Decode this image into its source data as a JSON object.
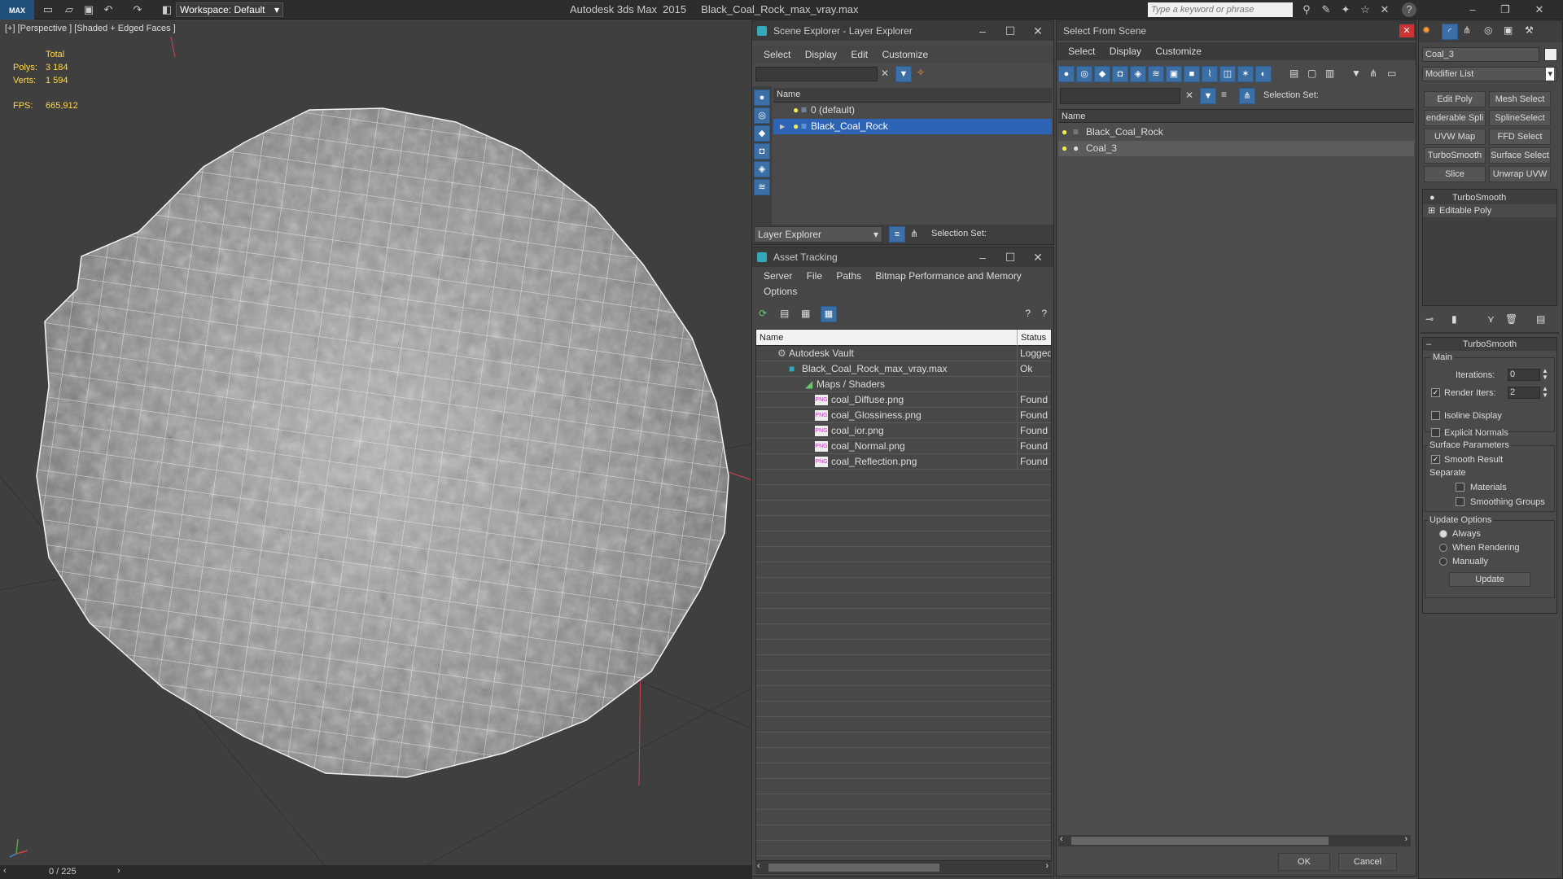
{
  "app": {
    "logo": "MAX",
    "workspace_label": "Workspace: Default",
    "window_title": "Autodesk 3ds Max  2015     Black_Coal_Rock_max_vray.max",
    "search_placeholder": "Type a keyword or phrase"
  },
  "viewport": {
    "label": "[+] [Perspective ] [Shaded + Edged Faces ]",
    "stats": {
      "total_label": "Total",
      "polys_label": "Polys:",
      "polys_value": "3 184",
      "verts_label": "Verts:",
      "verts_value": "1 594",
      "fps_label": "FPS:",
      "fps_value": "665,912"
    },
    "frame_counter": "0 / 225"
  },
  "scene_explorer": {
    "title": "Scene Explorer - Layer Explorer",
    "menu": [
      "Select",
      "Display",
      "Edit",
      "Customize"
    ],
    "column_name": "Name",
    "layers": [
      {
        "label": "0 (default)",
        "selected": false
      },
      {
        "label": "Black_Coal_Rock",
        "selected": true
      }
    ],
    "explorer_select": "Layer Explorer",
    "selection_set_label": "Selection Set:"
  },
  "asset_tracking": {
    "title": "Asset Tracking",
    "menu": [
      "Server",
      "File",
      "Paths",
      "Bitmap Performance and Memory",
      "Options"
    ],
    "col_name": "Name",
    "col_status": "Status",
    "rows": [
      {
        "name": "Autodesk Vault",
        "status": "Logged",
        "indent": 0
      },
      {
        "name": "Black_Coal_Rock_max_vray.max",
        "status": "Ok",
        "indent": 1
      },
      {
        "name": "Maps / Shaders",
        "status": "",
        "indent": 2
      },
      {
        "name": "coal_Diffuse.png",
        "status": "Found",
        "indent": 3
      },
      {
        "name": "coal_Glossiness.png",
        "status": "Found",
        "indent": 3
      },
      {
        "name": "coal_ior.png",
        "status": "Found",
        "indent": 3
      },
      {
        "name": "coal_Normal.png",
        "status": "Found",
        "indent": 3
      },
      {
        "name": "coal_Reflection.png",
        "status": "Found",
        "indent": 3
      }
    ]
  },
  "select_from_scene": {
    "title": "Select From Scene",
    "menu": [
      "Select",
      "Display",
      "Customize"
    ],
    "selection_set_label": "Selection Set:",
    "column_name": "Name",
    "items": [
      {
        "label": "Black_Coal_Rock",
        "selected": false
      },
      {
        "label": "Coal_3",
        "selected": true
      }
    ],
    "ok_label": "OK",
    "cancel_label": "Cancel"
  },
  "command_panel": {
    "object_name": "Coal_3",
    "modifier_list": "Modifier List",
    "buttons": [
      [
        "Edit Poly",
        "Mesh Select"
      ],
      [
        "enderable Spli",
        "SplineSelect"
      ],
      [
        "UVW Map",
        "FFD Select"
      ],
      [
        "TurboSmooth",
        "Surface Select"
      ],
      [
        "Slice",
        "Unwrap UVW"
      ]
    ],
    "stack": [
      "TurboSmooth",
      "Editable Poly"
    ],
    "rollout_title": "TurboSmooth",
    "main_label": "Main",
    "iterations_label": "Iterations:",
    "iterations_value": "0",
    "render_iters_label": "Render Iters:",
    "render_iters_value": "2",
    "isoline_label": "Isoline Display",
    "explicit_normals_label": "Explicit Normals",
    "surface_params_label": "Surface Parameters",
    "smooth_result_label": "Smooth Result",
    "separate_label": "Separate",
    "materials_label": "Materials",
    "smoothing_groups_label": "Smoothing Groups",
    "update_options_label": "Update Options",
    "always_label": "Always",
    "when_rendering_label": "When Rendering",
    "manually_label": "Manually",
    "update_button": "Update"
  }
}
